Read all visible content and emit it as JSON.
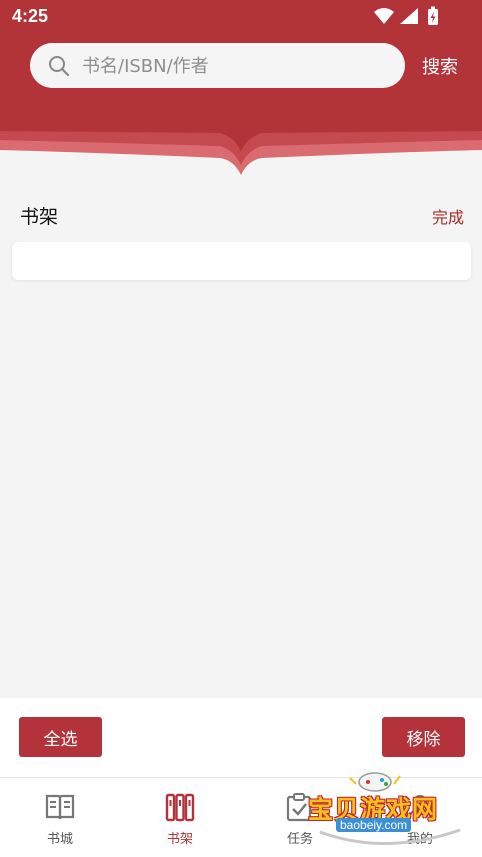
{
  "status_bar": {
    "time": "4:25"
  },
  "search": {
    "placeholder": "书名/ISBN/作者",
    "value": "",
    "button_label": "搜索"
  },
  "shelf": {
    "title": "书架",
    "done_label": "完成"
  },
  "actions": {
    "select_all_label": "全选",
    "remove_label": "移除"
  },
  "tabs": [
    {
      "label": "书城",
      "icon": "open-book-icon",
      "active": false
    },
    {
      "label": "书架",
      "icon": "bookshelf-icon",
      "active": true
    },
    {
      "label": "任务",
      "icon": "clipboard-check-icon",
      "active": false
    },
    {
      "label": "我的",
      "icon": "user-icon",
      "active": false
    }
  ],
  "watermark": {
    "text": "宝贝游戏网",
    "url": "baobeiy.com"
  },
  "colors": {
    "brand_red": "#b4323a",
    "header_red": "#b23338",
    "background": "#f4f4f4"
  }
}
